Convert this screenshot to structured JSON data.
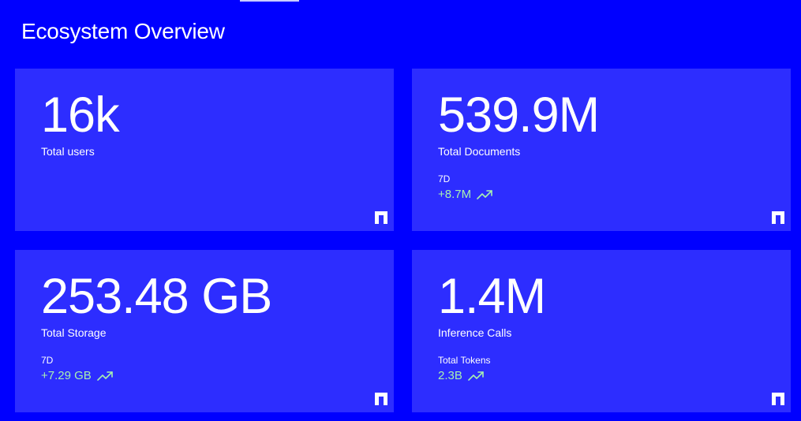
{
  "page": {
    "title": "Ecosystem Overview"
  },
  "colors": {
    "background": "#0000ff",
    "card": "#2d2dff",
    "text": "#ffffff",
    "positive": "#a8f0b0"
  },
  "cards": [
    {
      "value": "16k",
      "label": "Total users"
    },
    {
      "value": "539.9M",
      "label": "Total Documents",
      "sublabel": "7D",
      "delta": "+8.7M",
      "trend_icon": "trending-up-icon"
    },
    {
      "value": "253.48 GB",
      "label": "Total Storage",
      "sublabel": "7D",
      "delta": "+7.29 GB",
      "trend_icon": "trending-up-icon"
    },
    {
      "value": "1.4M",
      "label": "Inference Calls",
      "sublabel": "Total Tokens",
      "delta": "2.3B",
      "trend_icon": "trending-up-icon"
    }
  ],
  "brand_icon": "brand-logo-icon"
}
